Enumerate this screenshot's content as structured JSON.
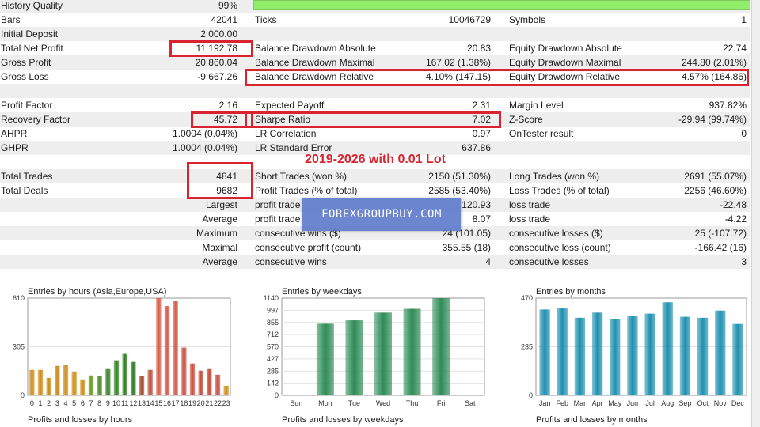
{
  "report": {
    "rows": [
      {
        "cells": [
          {
            "label": "History Quality",
            "value": "99%"
          },
          null,
          null
        ]
      },
      {
        "cells": [
          {
            "label": "Bars",
            "value": "42041"
          },
          {
            "label": "Ticks",
            "value": "10046729"
          },
          {
            "label": "Symbols",
            "value": "1"
          }
        ]
      },
      {
        "cells": [
          {
            "label": "Initial Deposit",
            "value": "2 000.00"
          },
          null,
          null
        ]
      },
      {
        "cells": [
          {
            "label": "Total Net Profit",
            "value": "11 192.78"
          },
          {
            "label": "Balance Drawdown Absolute",
            "value": "20.83"
          },
          {
            "label": "Equity Drawdown Absolute",
            "value": "22.74"
          }
        ]
      },
      {
        "cells": [
          {
            "label": "Gross Profit",
            "value": "20 860.04"
          },
          {
            "label": "Balance Drawdown Maximal",
            "value": "167.02 (1.38%)"
          },
          {
            "label": "Equity Drawdown Maximal",
            "value": "244.80 (2.01%)"
          }
        ]
      },
      {
        "cells": [
          {
            "label": "Gross Loss",
            "value": "-9 667.26"
          },
          {
            "label": "Balance Drawdown Relative",
            "value": "4.10% (147.15)"
          },
          {
            "label": "Equity Drawdown Relative",
            "value": "4.57% (164.86)"
          }
        ]
      },
      {
        "cells": [
          null,
          null,
          null
        ]
      },
      {
        "cells": [
          {
            "label": "Profit Factor",
            "value": "2.16"
          },
          {
            "label": "Expected Payoff",
            "value": "2.31"
          },
          {
            "label": "Margin Level",
            "value": "937.82%"
          }
        ]
      },
      {
        "cells": [
          {
            "label": "Recovery Factor",
            "value": "45.72"
          },
          {
            "label": "Sharpe Ratio",
            "value": "7.02"
          },
          {
            "label": "Z-Score",
            "value": "-29.94 (99.74%)"
          }
        ]
      },
      {
        "cells": [
          {
            "label": "AHPR",
            "value": "1.0004 (0.04%)"
          },
          {
            "label": "LR Correlation",
            "value": "0.97"
          },
          {
            "label": "OnTester result",
            "value": "0"
          }
        ]
      },
      {
        "cells": [
          {
            "label": "GHPR",
            "value": "1.0004 (0.04%)"
          },
          {
            "label": "LR Standard Error",
            "value": "637.86"
          },
          null
        ]
      },
      {
        "cells": [
          null,
          null,
          null
        ]
      },
      {
        "cells": [
          {
            "label": "Total Trades",
            "value": "4841"
          },
          {
            "label": "Short Trades (won %)",
            "value": "2150 (51.30%)"
          },
          {
            "label": "Long Trades (won %)",
            "value": "2691 (55.07%)"
          }
        ]
      },
      {
        "cells": [
          {
            "label": "Total Deals",
            "value": "9682"
          },
          {
            "label": "Profit Trades (% of total)",
            "value": "2585 (53.40%)"
          },
          {
            "label": "Loss Trades (% of total)",
            "value": "2256 (46.60%)"
          }
        ]
      },
      {
        "cells": [
          {
            "label": "",
            "value": "Largest"
          },
          {
            "label": "profit trade",
            "value": "120.93"
          },
          {
            "label": "loss trade",
            "value": "-22.48"
          }
        ]
      },
      {
        "cells": [
          {
            "label": "",
            "value": "Average"
          },
          {
            "label": "profit trade",
            "value": "8.07"
          },
          {
            "label": "loss trade",
            "value": "-4.22"
          }
        ]
      },
      {
        "cells": [
          {
            "label": "",
            "value": "Maximum"
          },
          {
            "label": "consecutive wins ($)",
            "value": "24 (101.05)"
          },
          {
            "label": "consecutive losses ($)",
            "value": "25 (-107.72)"
          }
        ]
      },
      {
        "cells": [
          {
            "label": "",
            "value": "Maximal"
          },
          {
            "label": "consecutive profit (count)",
            "value": "355.55 (18)"
          },
          {
            "label": "consecutive loss (count)",
            "value": "-166.42 (16)"
          }
        ]
      },
      {
        "cells": [
          {
            "label": "",
            "value": "Average"
          },
          {
            "label": "consecutive wins",
            "value": "4"
          },
          {
            "label": "consecutive losses",
            "value": "3"
          }
        ]
      }
    ],
    "banner": "2019-2026 with 0.01 Lot",
    "watermark": "FOREXGROUPBUY.COM"
  },
  "colors": {
    "highlight": "#d9232e",
    "quality_bar": "#90ee6a",
    "row_alt": "#eeeeee"
  },
  "chart_data": [
    {
      "type": "bar",
      "title": "Entries by hours (Asia,Europe,USA)",
      "categories": [
        "0",
        "1",
        "2",
        "3",
        "4",
        "5",
        "6",
        "7",
        "8",
        "9",
        "10",
        "11",
        "12",
        "13",
        "14",
        "15",
        "16",
        "17",
        "18",
        "19",
        "20",
        "21",
        "22",
        "23"
      ],
      "values": [
        160,
        160,
        110,
        185,
        190,
        150,
        100,
        125,
        120,
        165,
        220,
        260,
        210,
        120,
        160,
        610,
        560,
        590,
        300,
        200,
        155,
        165,
        130,
        60
      ],
      "colors": [
        "#cc8a14",
        "#cc8a14",
        "#cc8a14",
        "#cc8a14",
        "#cc8a14",
        "#cc8a14",
        "#cc8a14",
        "#6a9a1e",
        "#4e8f22",
        "#2e7d1f",
        "#2e7d1f",
        "#2e7d1f",
        "#2e7d1f",
        "#a34a2a",
        "#b84a36",
        "#d85a48",
        "#d85a48",
        "#d85a48",
        "#c84a3a",
        "#c84a3a",
        "#c84a3a",
        "#c84a3a",
        "#c84a3a",
        "#cc8a14"
      ],
      "yticks": [
        "0",
        "305",
        "610"
      ],
      "ylim": [
        0,
        610
      ]
    },
    {
      "type": "bar",
      "title": "Entries by weekdays",
      "categories": [
        "Sun",
        "Mon",
        "Tue",
        "Wed",
        "Thu",
        "Fri",
        "Sat"
      ],
      "values": [
        0,
        840,
        880,
        970,
        1015,
        1140,
        0
      ],
      "colors": [
        "#2e8b57",
        "#2e8b57",
        "#2e8b57",
        "#2e8b57",
        "#2e8b57",
        "#2e8b57",
        "#2e8b57"
      ],
      "yticks": [
        "0",
        "142",
        "285",
        "427",
        "570",
        "712",
        "855",
        "997",
        "1140"
      ],
      "ylim": [
        0,
        1140
      ]
    },
    {
      "type": "bar",
      "title": "Entries by months",
      "categories": [
        "Jan",
        "Feb",
        "Mar",
        "Apr",
        "May",
        "Jun",
        "Jul",
        "Aug",
        "Sep",
        "Oct",
        "Nov",
        "Dec"
      ],
      "values": [
        415,
        420,
        375,
        400,
        370,
        385,
        395,
        450,
        380,
        375,
        410,
        345
      ],
      "colors": [
        "#1e90b0",
        "#1e90b0",
        "#1e90b0",
        "#1e90b0",
        "#1e90b0",
        "#1e90b0",
        "#1e90b0",
        "#1e90b0",
        "#1e90b0",
        "#1e90b0",
        "#1e90b0",
        "#1e90b0"
      ],
      "yticks": [
        "0",
        "235",
        "470"
      ],
      "ylim": [
        0,
        470
      ]
    }
  ],
  "bottom_titles": [
    "Profits and losses by hours",
    "Profits and losses by weekdays",
    "Profits and losses by months"
  ]
}
